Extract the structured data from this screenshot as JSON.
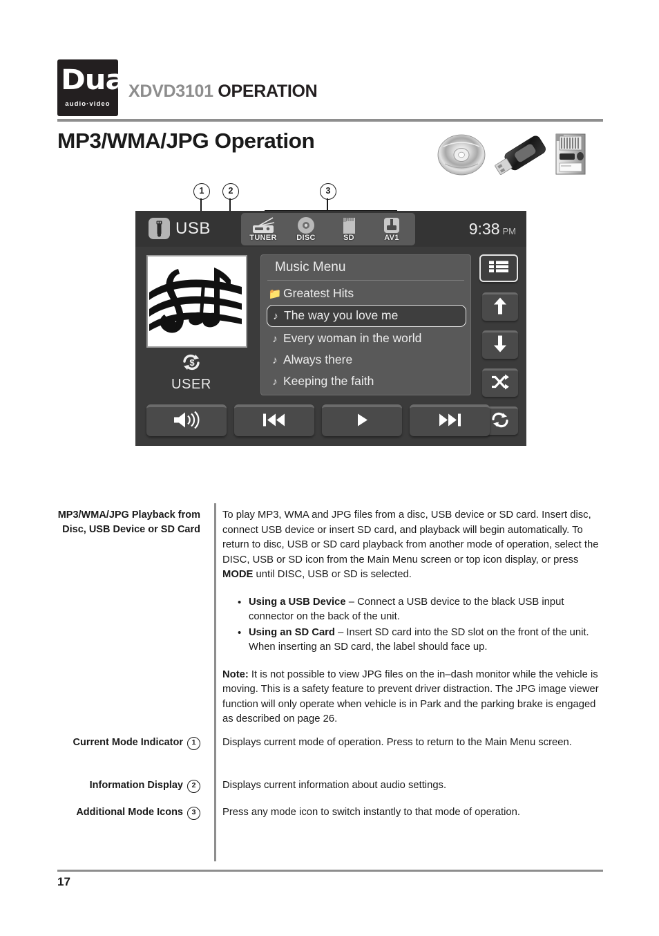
{
  "header": {
    "brand": "Dual",
    "brand_sub": "audio·video",
    "brand_reg": "®",
    "model": "XDVD3101",
    "section": "OPERATION"
  },
  "page": {
    "title": "MP3/WMA/JPG Operation",
    "number": "17"
  },
  "media_icons": [
    {
      "name": "disc-icon",
      "label": "Disc"
    },
    {
      "name": "usb-drive-icon",
      "label": "USB Drive"
    },
    {
      "name": "sd-card-icon",
      "label": "SD Card"
    }
  ],
  "callouts": [
    {
      "num": "1",
      "label": "Current Mode Indicator"
    },
    {
      "num": "2",
      "label": "Information Display"
    },
    {
      "num": "3",
      "label": "Additional Mode Icons"
    }
  ],
  "device_screen": {
    "source_label": "USB",
    "source_icon": "usb-icon",
    "clock_time": "9:38",
    "clock_ampm": "PM",
    "mode_icons": [
      {
        "name": "tuner-icon",
        "label": "TUNER"
      },
      {
        "name": "disc-icon",
        "label": "DISC"
      },
      {
        "name": "sd-icon",
        "label": "SD"
      },
      {
        "name": "av1-icon",
        "label": "AV1"
      }
    ],
    "album_art_alt": "music-notes-artwork",
    "repeat_icon": "repeat-user-icon",
    "eq_label": "USER",
    "menu": {
      "title": "Music Menu",
      "items": [
        {
          "glyph": "folder",
          "label": "Greatest Hits",
          "selected": false
        },
        {
          "glyph": "note",
          "label": "The way you love me",
          "selected": true
        },
        {
          "glyph": "note",
          "label": "Every woman in the world",
          "selected": false
        },
        {
          "glyph": "note",
          "label": "Always there",
          "selected": false
        },
        {
          "glyph": "note",
          "label": "Keeping the faith",
          "selected": false
        }
      ]
    },
    "side_buttons": [
      {
        "name": "list-view-button",
        "icon": "list-icon"
      },
      {
        "name": "scroll-up-button",
        "icon": "arrow-up-icon"
      },
      {
        "name": "scroll-down-button",
        "icon": "arrow-down-icon"
      },
      {
        "name": "shuffle-button",
        "icon": "shuffle-icon"
      },
      {
        "name": "repeat-button",
        "icon": "repeat-icon"
      }
    ],
    "bottom_buttons": [
      {
        "name": "volume-button",
        "icon": "speaker-icon"
      },
      {
        "name": "previous-track-button",
        "icon": "previous-icon"
      },
      {
        "name": "play-button",
        "icon": "play-icon"
      },
      {
        "name": "next-track-button",
        "icon": "next-icon"
      }
    ]
  },
  "content": {
    "section1": {
      "label": "MP3/WMA/JPG Playback from Disc, USB Device or SD Card",
      "paragraph_a": "To play MP3, WMA and JPG files from a disc, USB device or SD card. Insert disc, connect USB device or insert SD card, and playback will begin automatically. To return to disc, USB or SD card playback from another mode of operation, select the DISC, USB or SD icon from the Main Menu screen or top icon display, or press ",
      "paragraph_a_bold": "MODE",
      "paragraph_a_tail": " until DISC, USB or SD is selected.",
      "bullets": [
        {
          "bold": "Using a USB Device",
          "text": " – Connect a USB device to the black USB input connector on the back of the unit."
        },
        {
          "bold": "Using an SD Card",
          "text": " – Insert SD card into the SD slot on the front of the unit. When inserting an SD card, the label should face up."
        }
      ],
      "note_label": "Note:",
      "note_text": " It is not possible to view JPG files on the in–dash monitor while the vehicle is moving. This is a safety feature to prevent driver distraction. The JPG image viewer function will only operate when vehicle is in Park and the parking brake is engaged as described on page 26."
    },
    "section2": {
      "label": "Current Mode Indicator",
      "callout": "1",
      "text": "Displays current mode of operation. Press to return to the Main Menu screen."
    },
    "section3": {
      "label": "Information Display",
      "callout": "2",
      "text": "Displays current information about audio settings."
    },
    "section4": {
      "label": "Additional Mode Icons",
      "callout": "3",
      "text": "Press any mode icon to switch instantly to that mode of operation."
    }
  }
}
